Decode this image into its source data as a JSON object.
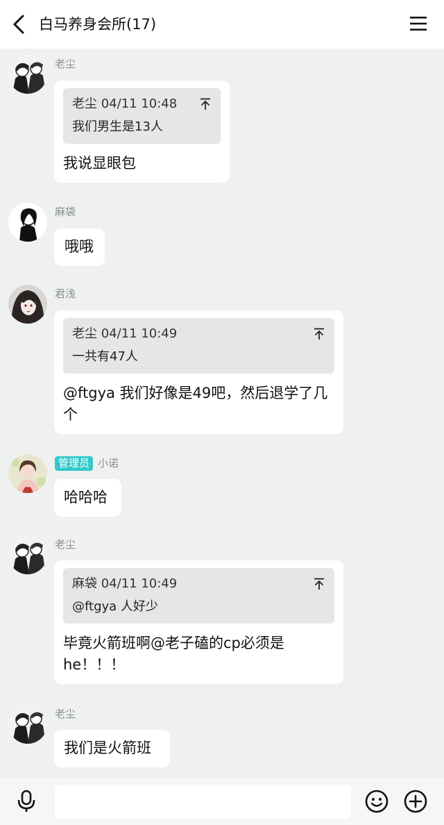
{
  "header": {
    "title": "白马养身会所(17)"
  },
  "messages": [
    {
      "sender": "老尘",
      "avatar": "avatar-laochen",
      "quote": {
        "head": "老尘 04/11 10:48",
        "body": "我们男生是13人"
      },
      "text": "我说显眼包"
    },
    {
      "sender": "麻袋",
      "avatar": "avatar-madai",
      "text": "哦哦"
    },
    {
      "sender": "君浅",
      "avatar": "avatar-junqian",
      "quote": {
        "head": "老尘 04/11 10:49",
        "body": "一共有47人"
      },
      "text": "@ftgya 我们好像是49吧，然后退学了几个"
    },
    {
      "sender": "小诺",
      "role_badge": "管理员",
      "avatar": "avatar-xiaonuo",
      "text": "哈哈哈"
    },
    {
      "sender": "老尘",
      "avatar": "avatar-laochen",
      "quote": {
        "head": "麻袋 04/11 10:49",
        "body": "@ftgya 人好少"
      },
      "text": "毕竟火箭班啊@老子磕的cp必须是he！！！"
    },
    {
      "sender": "老尘",
      "avatar": "avatar-laochen",
      "text": "我们是火箭班"
    }
  ],
  "composer": {
    "placeholder": ""
  },
  "icons": {
    "back": "chevron-left-icon",
    "menu": "menu-icon",
    "quote_jump": "arrow-up-to-top-icon",
    "mic": "microphone-icon",
    "emoji": "smiley-icon",
    "plus": "plus-circle-icon"
  },
  "colors": {
    "background": "#eef1ef",
    "bubble": "#ffffff",
    "quote": "#e6e6e6",
    "badge": "#33c9c9",
    "meta": "#8a8f8c"
  }
}
